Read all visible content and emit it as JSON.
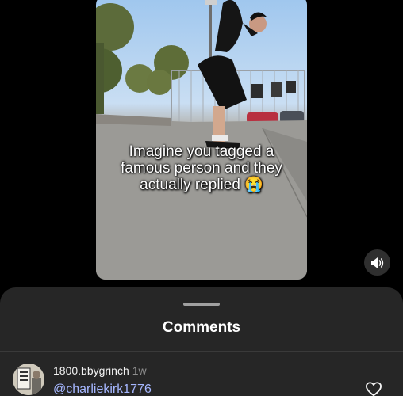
{
  "video": {
    "caption_lines": [
      "Imagine you tagged a",
      "famous person and they",
      "actually replied 😭"
    ]
  },
  "controls": {
    "sound_icon": "speaker-icon"
  },
  "comments_sheet": {
    "title": "Comments",
    "comments": [
      {
        "username": "1800.bbygrinch",
        "time": "1w",
        "text": "@charliekirk1776"
      }
    ]
  },
  "colors": {
    "background": "#000000",
    "sheet": "#262626",
    "mention": "#a6b7ff",
    "time": "#8e8e8e"
  }
}
